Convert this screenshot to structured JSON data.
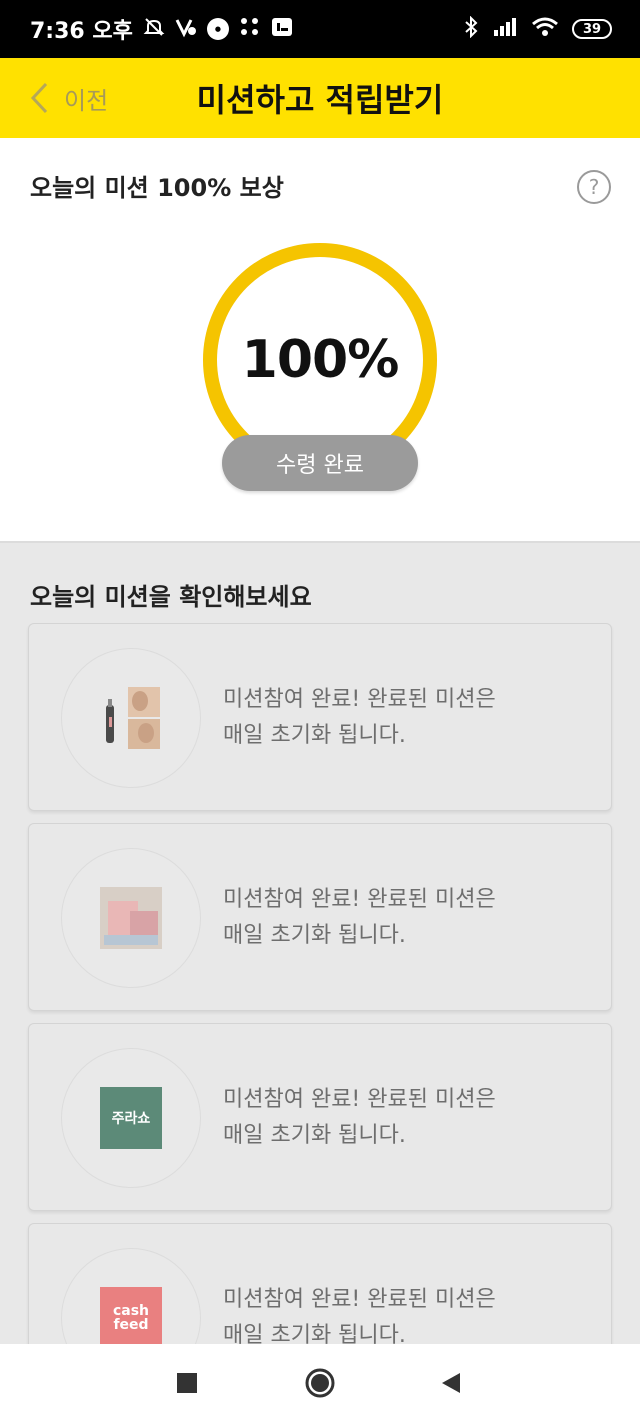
{
  "status_bar": {
    "time": "7:36 오후",
    "battery": "39"
  },
  "header": {
    "back_label": "이전",
    "title": "미션하고 적립받기"
  },
  "reward": {
    "title": "오늘의 미션 100% 보상",
    "progress_text": "100%",
    "progress_fraction": 1.0,
    "claim_button": "수령 완료",
    "accent_color": "#f5c400"
  },
  "missions": {
    "section_title": "오늘의 미션을 확인해보세요",
    "items": [
      {
        "thumb": "foot-care-product",
        "line1": "미션참여 완료!  완료된 미션은",
        "line2": "매일 초기화 됩니다."
      },
      {
        "thumb": "pink-fabric-product",
        "line1": "미션참여 완료!  완료된 미션은",
        "line2": "매일 초기화 됩니다."
      },
      {
        "thumb_text": "주라쇼",
        "line1": "미션참여 완료!  완료된 미션은",
        "line2": "매일 초기화 됩니다."
      },
      {
        "thumb_text_1": "cash",
        "thumb_text_2": "feed",
        "line1": "미션참여 완료!  완료된 미션은",
        "line2": "매일 초기화 됩니다."
      }
    ]
  }
}
